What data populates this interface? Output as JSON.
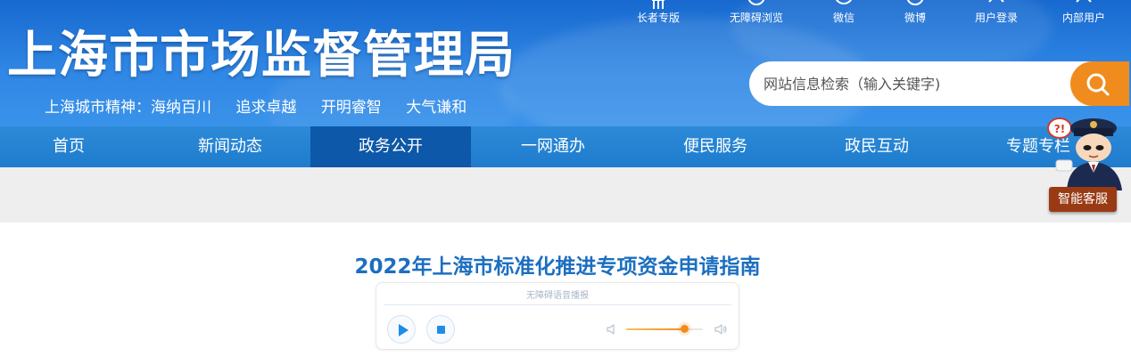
{
  "header": {
    "site_title": "上海市市场监督管理局",
    "slogan": [
      "上海城市精神：海纳百川",
      "追求卓越",
      "开明睿智",
      "大气谦和"
    ],
    "toolbar": [
      {
        "label": "长者专版",
        "icon": "elder-icon"
      },
      {
        "label": "无障碍浏览",
        "icon": "accessibility-icon"
      },
      {
        "label": "微信",
        "icon": "wechat-icon"
      },
      {
        "label": "微博",
        "icon": "weibo-icon"
      },
      {
        "label": "用户登录",
        "icon": "user-icon"
      },
      {
        "label": "内部用户",
        "icon": "user-icon"
      }
    ],
    "search": {
      "placeholder": "网站信息检索（输入关键字)",
      "button_icon": "search-icon"
    }
  },
  "nav": {
    "items": [
      "首页",
      "新闻动态",
      "政务公开",
      "一网通办",
      "便民服务",
      "政民互动",
      "专题专栏"
    ],
    "active_index": 2
  },
  "assistant": {
    "label": "智能客服"
  },
  "article": {
    "title": "2022年上海市标准化推进专项资金申请指南",
    "audio": {
      "caption": "无障碍语音播报",
      "volume": 0.75
    }
  },
  "colors": {
    "header_blue": "#1769cf",
    "nav_blue": "#1f7ccd",
    "nav_active": "#0d58a8",
    "accent_orange": "#f08c1e",
    "title_blue": "#1c6fc0"
  }
}
